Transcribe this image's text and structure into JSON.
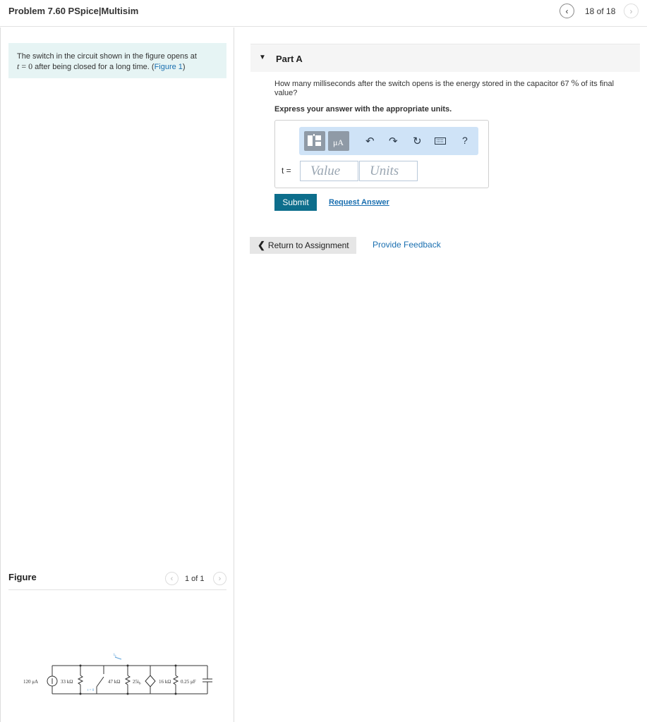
{
  "header": {
    "problem_title": "Problem 7.60 PSpice|Multisim",
    "prev_icon": "‹",
    "counter": "18 of 18",
    "next_icon": "›"
  },
  "prompt": {
    "text_before": "The switch in the circuit shown in the figure opens at",
    "math_var": "t",
    "math_rest": " = 0",
    "text_after": " after being closed for a long time. (",
    "figure_link": "Figure 1",
    "text_end": ")"
  },
  "figure": {
    "title": "Figure",
    "counter": "1 of 1",
    "circuit_labels": {
      "source": "120 μA",
      "r1": "33 kΩ",
      "r2": "47 kΩ",
      "dep": "25i",
      "dep_sub": "b",
      "r3": "16 kΩ",
      "cap": "0.25 μF",
      "switch": "t = 0",
      "current": "i",
      "current_sub": "b"
    }
  },
  "part_a": {
    "label": "Part A",
    "question_before": "How many milliseconds after the switch opens is the energy stored in the capacitor 67 ",
    "question_percent": "%",
    "question_after": " of its final value?",
    "instruction": "Express your answer with the appropriate units.",
    "answer_label": "t =",
    "value_placeholder": "Value",
    "units_placeholder": "Units",
    "toolbar_mu": "μA",
    "toolbar_help": "?",
    "submit_label": "Submit",
    "request_answer_label": "Request Answer"
  },
  "footer": {
    "return_label": "Return to Assignment",
    "feedback_label": "Provide Feedback"
  },
  "colors": {
    "accent": "#0d6e8c",
    "link": "#1a6fb0",
    "prompt_bg": "#e6f4f4",
    "toolbar_bg": "#cfe3f7"
  }
}
